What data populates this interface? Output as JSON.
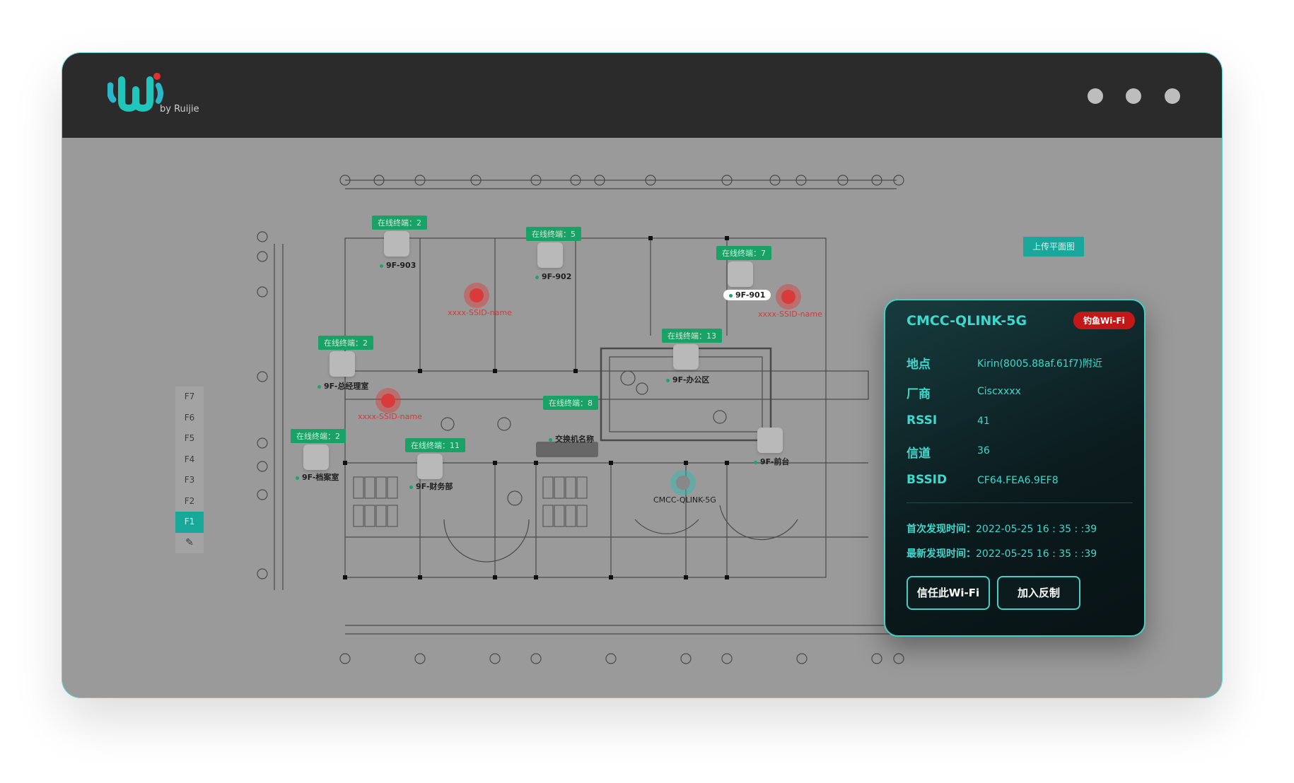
{
  "app": {
    "logo_by": "by Ruijie"
  },
  "toolbar": {
    "upload_label": "上传平面图"
  },
  "floors": [
    "F7",
    "F6",
    "F5",
    "F4",
    "F3",
    "F2",
    "F1"
  ],
  "active_floor": "F1",
  "floorplan": {
    "aps": [
      {
        "tag": "在线终端：2",
        "name": "9F-903"
      },
      {
        "tag": "在线终端：5",
        "name": "9F-902"
      },
      {
        "tag": "在线终端：7",
        "name": "9F-901"
      },
      {
        "tag": "在线终端：2",
        "name": "9F-总经理室"
      },
      {
        "tag": "在线终端：13",
        "name": "9F-办公区"
      },
      {
        "tag": "在线终端：8",
        "name": "交换机名称"
      },
      {
        "tag": "在线终端：2",
        "name": "9F-档案室"
      },
      {
        "tag": "在线终端：11",
        "name": "9F-财务部"
      },
      {
        "tag": "",
        "name": "9F-前台"
      }
    ],
    "rogues": [
      {
        "label": "xxxx-SSID-name"
      },
      {
        "label": "xxxx-SSID-name"
      },
      {
        "label": "xxxx-SSID-name"
      },
      {
        "label": "CMCC-QLINK-5G"
      }
    ]
  },
  "detail": {
    "ssid": "CMCC-QLINK-5G",
    "badge": "钓鱼Wi-Fi",
    "location_label": "地点",
    "location": "Kirin(8005.88af.61f7)附近",
    "vendor_label": "厂商",
    "vendor": "Ciscxxxx",
    "rssi_label": "RSSI",
    "rssi": "41",
    "channel_label": "信道",
    "channel": "36",
    "bssid_label": "BSSID",
    "bssid": "CF64.FEA6.9EF8",
    "first_seen_label": "首次发现时间：",
    "first_seen": "2022-05-25  16 : 35 : :39",
    "last_seen_label": "最新发现时间：",
    "last_seen": "2022-05-25  16 : 35 : :39",
    "trust_button": "信任此Wi-Fi",
    "counter_button": "加入反制"
  },
  "colors": {
    "accent": "#3fd8cc",
    "danger": "#c31818",
    "online": "#18a266"
  }
}
